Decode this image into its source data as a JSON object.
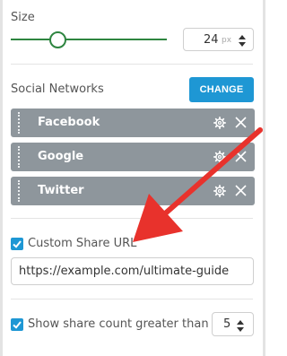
{
  "size": {
    "label": "Size",
    "value": "24",
    "unit": "px",
    "slider_level_percent": 34
  },
  "social": {
    "label": "Social Networks",
    "change_label": "CHANGE",
    "networks": [
      {
        "name": "Facebook"
      },
      {
        "name": "Google"
      },
      {
        "name": "Twitter"
      }
    ]
  },
  "custom_share": {
    "checked": true,
    "label": "Custom Share URL",
    "url_value": "https://example.com/ultimate-guide"
  },
  "share_count": {
    "checked": true,
    "label": "Show share count greater than",
    "value": "5"
  },
  "icons": {
    "gear": "gear-icon",
    "close": "close-icon",
    "check": "checkmark-icon",
    "arrow": "red-arrow-annotation"
  },
  "colors": {
    "accent": "#1e97d4",
    "slider": "#2e8540",
    "network_bg": "#8e969c",
    "arrow": "#e8322c"
  }
}
